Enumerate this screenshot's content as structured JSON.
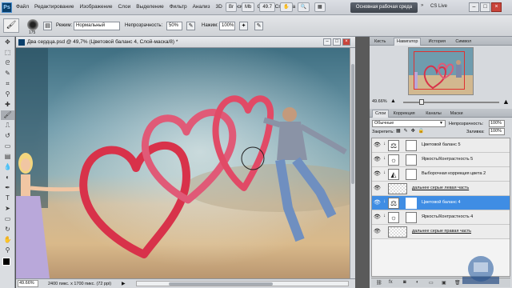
{
  "app": {
    "logo": "Ps",
    "menu": [
      "Файл",
      "Редактирование",
      "Изображение",
      "Слои",
      "Выделение",
      "Фильтр",
      "Анализ",
      "3D",
      "Просмотр",
      "Окно",
      "Справка"
    ],
    "zoom_level": "49.7",
    "workspace_label": "Основная рабочая среда",
    "cs_live": "CS Live"
  },
  "options": {
    "brush_size": "175",
    "mode_label": "Режим:",
    "mode_value": "Нормальный",
    "opacity_label": "Непрозрачность:",
    "opacity_value": "50%",
    "flow_label": "Нажим:",
    "flow_value": "100%"
  },
  "document": {
    "title": "Два сердца.psd @ 49,7% (Цветовой баланс 4, Слой-маска/8) *",
    "zoom": "49.66%",
    "info": "2400 пикс. x 1700 пикс. (72 ppi)"
  },
  "navigator": {
    "tabs": [
      "Кисть",
      "Навигатор",
      "История",
      "Символ"
    ],
    "active_tab": "Навигатор",
    "zoom": "49.66%"
  },
  "layers_panel": {
    "tabs": [
      "Слои",
      "Коррекция",
      "Каналы",
      "Маски"
    ],
    "active_tab": "Слои",
    "blend_mode": "Обычные",
    "opacity_label": "Непрозрачность:",
    "opacity_value": "100%",
    "lock_label": "Закрепить:",
    "fill_label": "Заливка:",
    "fill_value": "100%",
    "layers": [
      {
        "name": "Цветовой баланс 5",
        "type": "adjustment",
        "icon": "balance-icon",
        "selected": false
      },
      {
        "name": "Яркость/Контрастность 5",
        "type": "adjustment",
        "icon": "sun-icon",
        "selected": false
      },
      {
        "name": "Выборочная коррекция цвета 2",
        "type": "adjustment",
        "icon": "levels-icon",
        "selected": false
      },
      {
        "name": "дальнее серые левая часть",
        "type": "pixel",
        "selected": false
      },
      {
        "name": "Цветовой баланс 4",
        "type": "adjustment",
        "icon": "balance-icon",
        "selected": true
      },
      {
        "name": "Яркость/Контрастность 4",
        "type": "adjustment",
        "icon": "sun-icon",
        "selected": false
      },
      {
        "name": "дальнее серые правая часть",
        "type": "pixel",
        "selected": false
      }
    ]
  },
  "colors": {
    "selected_layer": "#3f8de4",
    "heart_red": "#d8324a",
    "heart_pink": "#e05a77"
  }
}
